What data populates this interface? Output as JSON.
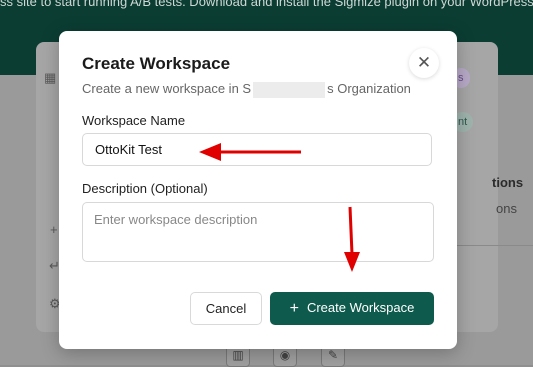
{
  "background": {
    "banner_text": "ss site to start running A/B tests. Download and install the Sigmize plugin on your WordPress",
    "badge_top": "s",
    "badge_mid": "nt",
    "heading_fragment": "tions",
    "subtext_fragment": "ons",
    "icons": [
      "building-icon",
      "plus-icon",
      "return-icon",
      "gear-icon",
      "chart-icon",
      "eye-icon",
      "edit-icon"
    ]
  },
  "modal": {
    "title": "Create Workspace",
    "subtitle_before": "Create a new workspace in S",
    "subtitle_after": "s Organization",
    "name_label": "Workspace Name",
    "name_value": "OttoKit Test",
    "description_label": "Description (Optional)",
    "description_placeholder": "Enter workspace description",
    "cancel_label": "Cancel",
    "create_label": "Create Workspace"
  },
  "colors": {
    "primary": "#0e5a4c",
    "annotation_arrow": "#e00000"
  }
}
